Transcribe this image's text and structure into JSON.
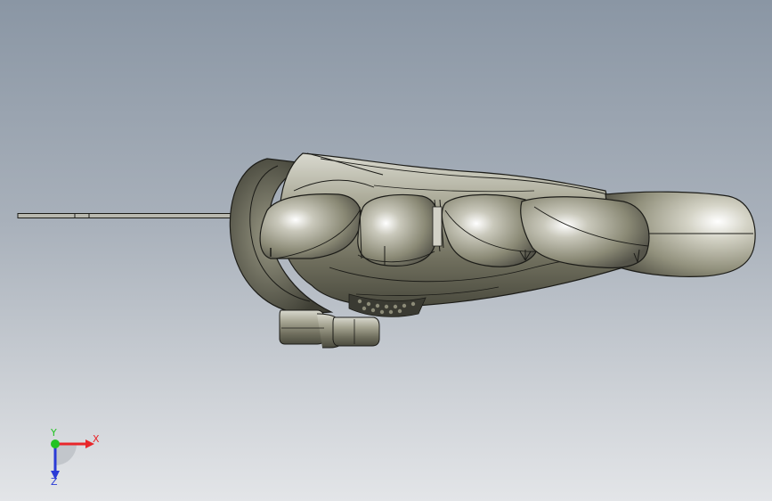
{
  "viewport": {
    "background_top": "#8a96a4",
    "background_bottom": "#e3e5e8",
    "model": {
      "name": "robotic hand",
      "body_color": "#8e8d79",
      "edge_color": "#1c1c18",
      "highlight_color": "#f4f4ee"
    }
  },
  "triad": {
    "x_label": "X",
    "y_label": "Y",
    "z_label": "Z",
    "x_color": "#e8262a",
    "y_color": "#22c322",
    "z_color": "#2a3bd6"
  }
}
